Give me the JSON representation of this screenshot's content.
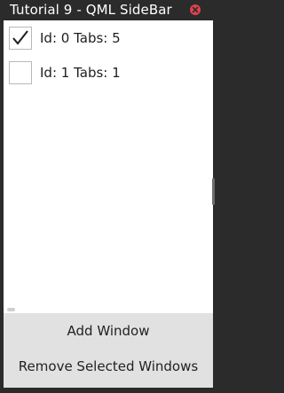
{
  "window": {
    "title": "Tutorial 9 - QML SideBar"
  },
  "list": {
    "items": [
      {
        "label": "Id: 0 Tabs: 5",
        "checked": true
      },
      {
        "label": "Id: 1 Tabs: 1",
        "checked": false
      }
    ]
  },
  "buttons": {
    "add_label": "Add Window",
    "remove_label": "Remove Selected Windows"
  },
  "colors": {
    "close_button": "#e0424c",
    "titlebar": "#2b2b2b",
    "button_area": "#e1e1e1"
  },
  "icons": {
    "close": "close-icon",
    "check": "checkmark-icon"
  }
}
